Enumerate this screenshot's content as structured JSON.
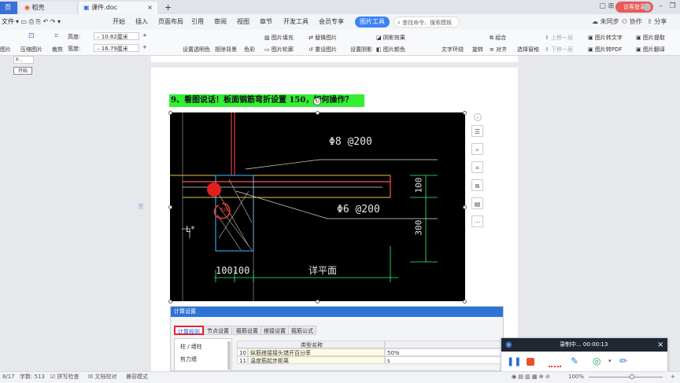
{
  "titlebar": {
    "tabs": [
      "页",
      "稻壳",
      "课件.doc"
    ],
    "add_tab": "+",
    "login": "访客登录"
  },
  "menubar": {
    "file": "文件",
    "items": [
      "开始",
      "插入",
      "页面布局",
      "引用",
      "审阅",
      "视图",
      "章节",
      "开发工具",
      "会员专享"
    ],
    "active": "图片工具",
    "search": "查找命令、搜索模板",
    "right": [
      "未同步",
      "协作",
      "分享"
    ]
  },
  "ribbon": {
    "left_labels": [
      "图片",
      "压缩图片",
      "裁剪"
    ],
    "height_label": "高度:",
    "height_value": "10.82厘米",
    "width_label": "宽度:",
    "width_value": "16.79厘米",
    "row1": [
      "图片填充",
      "替换图片",
      "阴影效果",
      "组合",
      "上移一层",
      "图片转文字",
      "图片提取"
    ],
    "row2": [
      "设置透明色",
      "抠除背景",
      "色彩",
      "图片轮廓",
      "重设图片",
      "设置阴影",
      "图片颜色",
      "文字环绕",
      "旋转",
      "对齐",
      "选择窗格",
      "下移一层",
      "图片转PDF",
      "图片翻译"
    ],
    "tooltip": "开始",
    "p_label": "P..."
  },
  "document": {
    "heading": "9、看图说话！板面钢筋弯折设置 150，如何操作？",
    "cad": {
      "label_top": "Φ8 @200",
      "label_mid": "Φ6 @200",
      "label_100": "100",
      "label_300": "300",
      "label_bottom_left": "100100",
      "label_detail": "详平面",
      "label_L": "L*",
      "label_50": "50"
    }
  },
  "settings": {
    "title": "计算设置",
    "tabs": [
      "计算规则",
      "节点设置",
      "箍筋设置",
      "搭接设置",
      "箍筋公式"
    ],
    "tree": [
      "柱 / 墙柱",
      "剪力墙"
    ],
    "col_header": "类型名称",
    "rows": [
      {
        "num": "10",
        "name": "纵筋搭接接头错开百分率",
        "value": "50%"
      },
      {
        "num": "11",
        "name": "温度筋起步距离",
        "value": "s"
      }
    ]
  },
  "statusbar": {
    "page": "8/17",
    "words": "字数: 513",
    "spell": "拼写检查",
    "proof": "文档校对",
    "compat": "兼容模式",
    "zoom": "100%"
  },
  "recorder": {
    "status": "录制中... 00:00:13",
    "close": "×"
  }
}
